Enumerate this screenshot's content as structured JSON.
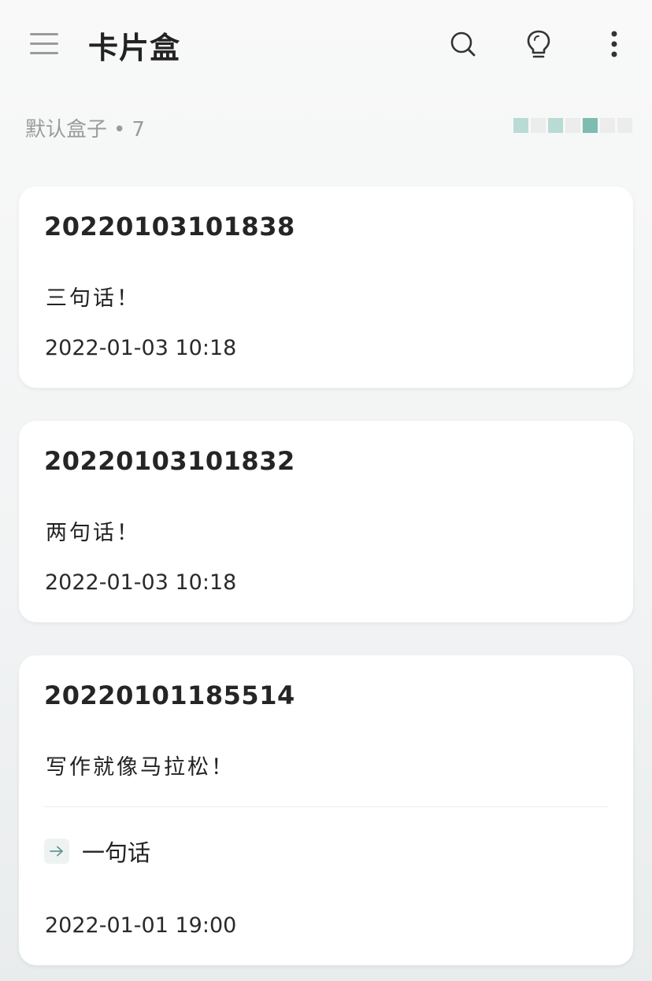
{
  "app": {
    "title": "卡片盒"
  },
  "header_icons": [
    "menu-icon",
    "search-icon",
    "lightbulb-icon",
    "more-vertical-icon"
  ],
  "box": {
    "name": "默认盒子",
    "separator": "•",
    "count": "7"
  },
  "heatmap_colors": [
    "#b8dcd5",
    "#ececec",
    "#b8dcd5",
    "#ececec",
    "#7fbcb0",
    "#ececec",
    "#ececec"
  ],
  "cards": [
    {
      "title": "20220103101838",
      "body": "三句话！",
      "time": "2022-01-03 10:18"
    },
    {
      "title": "20220103101832",
      "body": "两句话！",
      "time": "2022-01-03 10:18"
    },
    {
      "title": "20220101185514",
      "body": "写作就像马拉松！",
      "link": "一句话",
      "time": "2022-01-01 19:00"
    }
  ],
  "colors": {
    "accent": "#7fbcb0",
    "muted_text": "#9b9b9b",
    "card_bg": "#ffffff"
  }
}
